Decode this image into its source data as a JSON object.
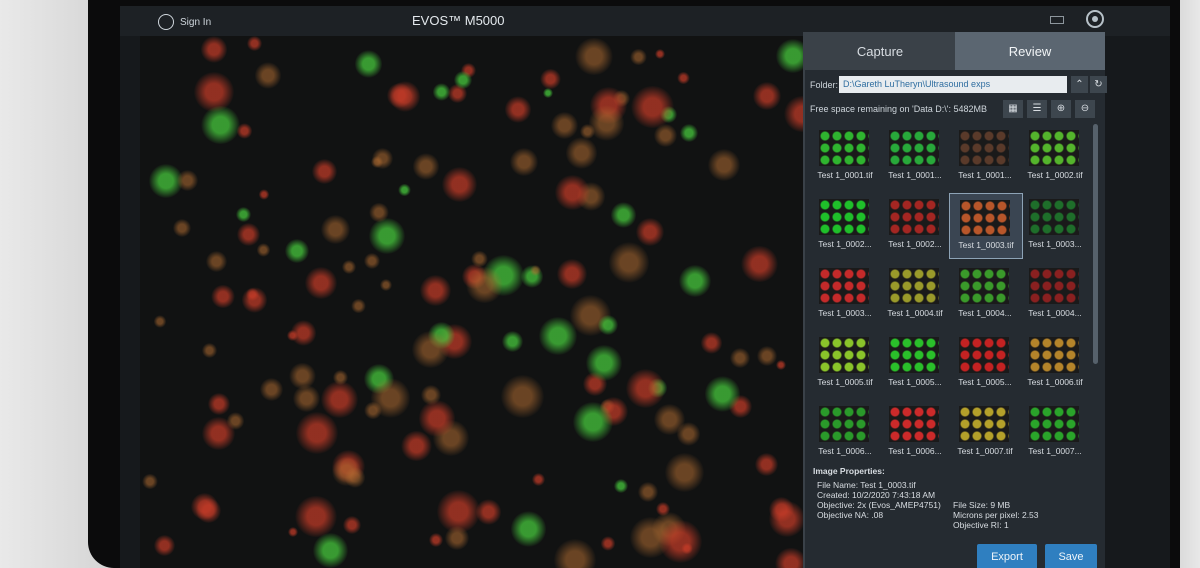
{
  "app": {
    "title": "EVOS™ M5000",
    "sign_in": "Sign In"
  },
  "tabs": [
    {
      "label": "Capture"
    },
    {
      "label": "Review"
    }
  ],
  "folder": {
    "label": "Folder:",
    "path": "D:\\Gareth LuTheryn\\Ultrasound exps"
  },
  "free_space": "Free space remaining on 'Data D:\\': 5482MB",
  "thumbnails": [
    {
      "label": "Test 1_0001.tif",
      "color": "#2fb42f"
    },
    {
      "label": "Test 1_0001...",
      "color": "#28a93a"
    },
    {
      "label": "Test 1_0001...",
      "color": "#5a3a2a"
    },
    {
      "label": "Test 1_0002.tif",
      "color": "#54b42c"
    },
    {
      "label": "Test 1_0002...",
      "color": "#1fbf2a"
    },
    {
      "label": "Test 1_0002...",
      "color": "#a42622"
    },
    {
      "label": "Test 1_0003.tif",
      "color": "#b8562a"
    },
    {
      "label": "Test 1_0003...",
      "color": "#1e6e2a"
    },
    {
      "label": "Test 1_0003...",
      "color": "#c42a2a"
    },
    {
      "label": "Test 1_0004.tif",
      "color": "#9a9a2a"
    },
    {
      "label": "Test 1_0004...",
      "color": "#3a9a2a"
    },
    {
      "label": "Test 1_0004...",
      "color": "#8a2020"
    },
    {
      "label": "Test 1_0005.tif",
      "color": "#8ac42a"
    },
    {
      "label": "Test 1_0005...",
      "color": "#2abf2a"
    },
    {
      "label": "Test 1_0005...",
      "color": "#c42222"
    },
    {
      "label": "Test 1_0006.tif",
      "color": "#b4842a"
    },
    {
      "label": "Test 1_0006...",
      "color": "#2a9a2a"
    },
    {
      "label": "Test 1_0006...",
      "color": "#cc2a2a"
    },
    {
      "label": "Test 1_0007.tif",
      "color": "#b4a02a"
    },
    {
      "label": "Test 1_0007...",
      "color": "#2aa42a"
    }
  ],
  "properties": {
    "heading": "Image Properties:",
    "file_name": "File Name: Test 1_0003.tif",
    "created": "Created: 10/2/2020 7:43:18 AM",
    "objective": "Objective: 2x (Evos_AMEP4751)",
    "objective_na": "Objective NA: .08",
    "file_size": "File Size: 9 MB",
    "microns": "Microns per pixel: 2.53",
    "objective_ri": "Objective RI: 1"
  },
  "buttons": {
    "export": "Export",
    "save": "Save"
  }
}
